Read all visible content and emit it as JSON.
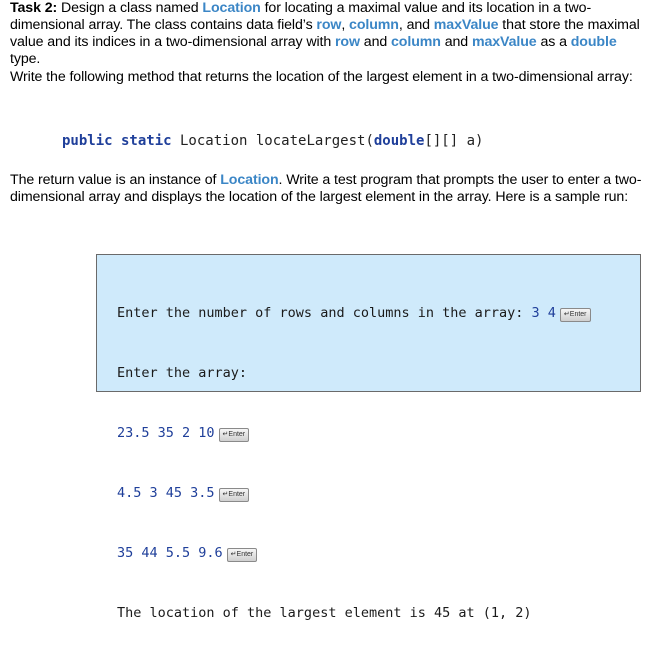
{
  "task": {
    "heading": "Task 2:",
    "t1": " Design a class named ",
    "t2": "Location",
    "t3": " for locating a maximal value and its location in a two-dimensional array. The class contains data field’s ",
    "t4": "row",
    "t5": ", ",
    "t6": "column",
    "t7": ", and ",
    "t8": "maxValue",
    "t9": " that store the maximal value and its indices in a two-dimensional array with ",
    "t10": "row",
    "t11": " and ",
    "t12": "column",
    "t13": " and ",
    "t14": "maxValue",
    "t15": " as a ",
    "t16": "double",
    "t17": " type."
  },
  "write_method": "Write the following method that returns the location of the largest element in a two-dimensional array:",
  "signature": {
    "modifiers": "public static",
    "return_type": " Location locateLargest(",
    "param_type": "double",
    "params_rest": "[][] a)"
  },
  "return_para": {
    "r1": "The return value is an instance of ",
    "r2": "Location",
    "r3": ". Write a test program that prompts the user to enter a two-dimensional array and displays the location of the largest element in the array. Here is a sample run:"
  },
  "sample_run": {
    "line1_prompt": "Enter the number of rows and columns in the array: ",
    "line1_input": "3 4",
    "line2": "Enter the array:",
    "row1": "23.5 35 2 10",
    "row2": "4.5 3 45 3.5",
    "row3": "35 44 5.5 9.6",
    "result": "The location of the largest element is 45 at (1, 2)",
    "enter_label": "↵Enter"
  }
}
